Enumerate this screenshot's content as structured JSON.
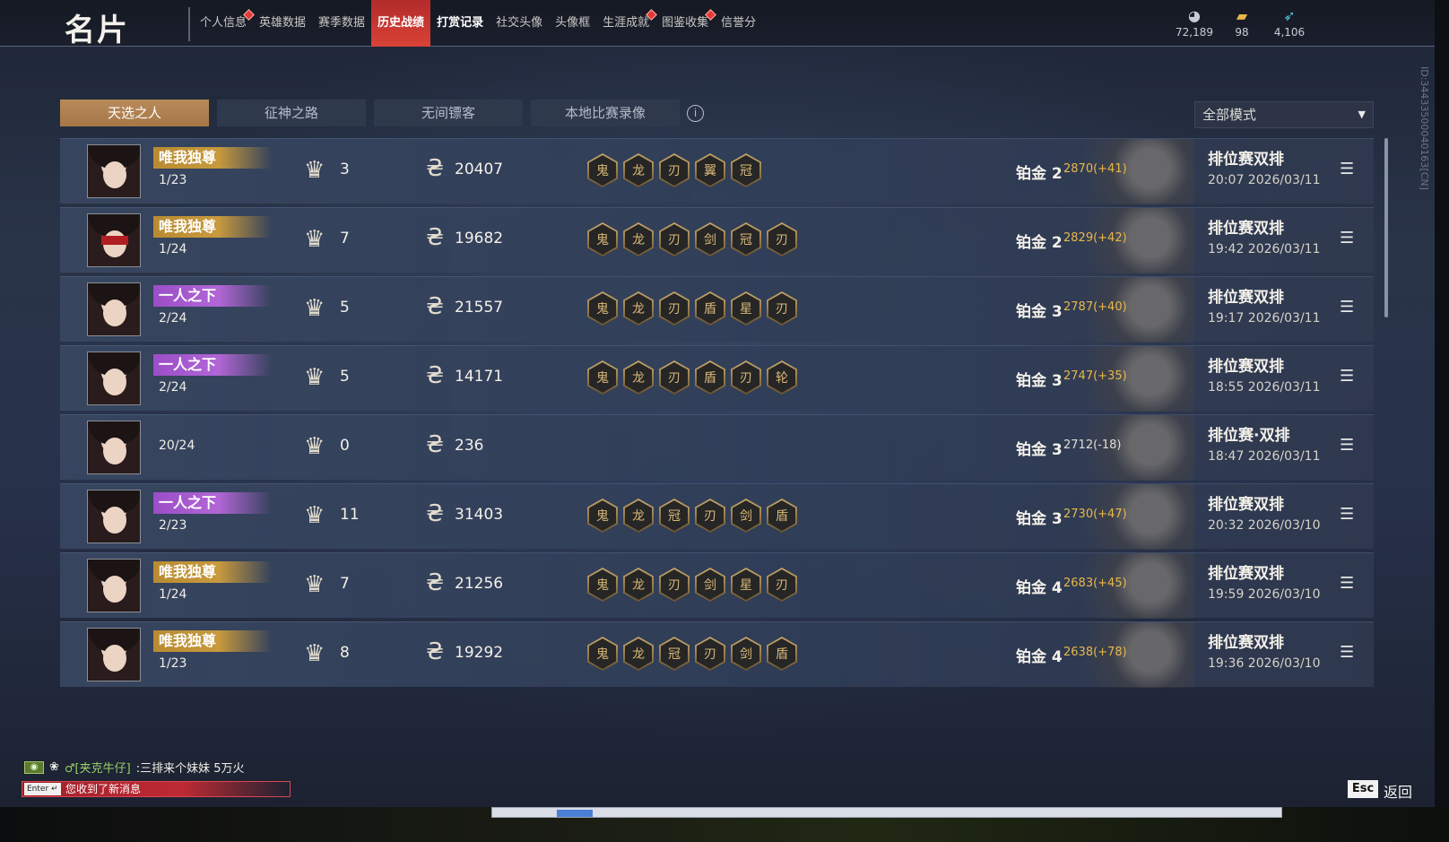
{
  "header": {
    "title": "名片",
    "nav": [
      {
        "label": "个人信息",
        "dot": true,
        "state": "normal"
      },
      {
        "label": "英雄数据",
        "dot": false,
        "state": "normal"
      },
      {
        "label": "赛季数据",
        "dot": false,
        "state": "normal"
      },
      {
        "label": "历史战绩",
        "dot": false,
        "state": "active"
      },
      {
        "label": "打赏记录",
        "dot": false,
        "state": "bold"
      },
      {
        "label": "社交头像",
        "dot": false,
        "state": "normal"
      },
      {
        "label": "头像框",
        "dot": false,
        "state": "normal"
      },
      {
        "label": "生涯成就",
        "dot": true,
        "state": "normal"
      },
      {
        "label": "图鉴收集",
        "dot": true,
        "state": "normal"
      },
      {
        "label": "信誉分",
        "dot": false,
        "state": "normal"
      }
    ],
    "currencies": [
      {
        "icon": "coin-stack-icon",
        "value": "72,189",
        "color": "#c8ccd4"
      },
      {
        "icon": "ticket-icon",
        "value": "98",
        "color": "#e8b84a"
      },
      {
        "icon": "feather-icon",
        "value": "4,106",
        "color": "#4ac8e0"
      }
    ]
  },
  "side_id": "ID:34433500040163[CN]",
  "tabs": [
    {
      "label": "天选之人",
      "active": true
    },
    {
      "label": "征神之路",
      "active": false
    },
    {
      "label": "无间镖客",
      "active": false
    },
    {
      "label": "本地比赛录像",
      "active": false
    }
  ],
  "mode_select": {
    "value": "全部模式"
  },
  "matches": [
    {
      "title": "唯我独尊",
      "title_color": "gold",
      "rank": "1/23",
      "kills": "3",
      "damage": "20407",
      "medals": [
        "鬼",
        "龙",
        "刃",
        "翼",
        "冠"
      ],
      "tier": "铂金 2",
      "score": "2870(+41)",
      "mode": "排位赛双排",
      "time": "20:07  2026/03/11",
      "avatar": "plain"
    },
    {
      "title": "唯我独尊",
      "title_color": "gold",
      "rank": "1/24",
      "kills": "7",
      "damage": "19682",
      "medals": [
        "鬼",
        "龙",
        "刃",
        "剑",
        "冠",
        "刃"
      ],
      "tier": "铂金 2",
      "score": "2829(+42)",
      "mode": "排位赛双排",
      "time": "19:42  2026/03/11",
      "avatar": "masked"
    },
    {
      "title": "一人之下",
      "title_color": "purple",
      "rank": "2/24",
      "kills": "5",
      "damage": "21557",
      "medals": [
        "鬼",
        "龙",
        "刃",
        "盾",
        "星",
        "刃"
      ],
      "tier": "铂金 3",
      "score": "2787(+40)",
      "mode": "排位赛双排",
      "time": "19:17  2026/03/11",
      "avatar": "plain"
    },
    {
      "title": "一人之下",
      "title_color": "purple",
      "rank": "2/24",
      "kills": "5",
      "damage": "14171",
      "medals": [
        "鬼",
        "龙",
        "刃",
        "盾",
        "刃",
        "轮"
      ],
      "tier": "铂金 3",
      "score": "2747(+35)",
      "mode": "排位赛双排",
      "time": "18:55  2026/03/11",
      "avatar": "plain"
    },
    {
      "title": "",
      "title_color": "none",
      "rank": "20/24",
      "kills": "0",
      "damage": "236",
      "medals": [],
      "tier": "铂金 3",
      "score": "2712(-18)",
      "mode": "排位赛·双排",
      "time": "18:47  2026/03/11",
      "avatar": "plain"
    },
    {
      "title": "一人之下",
      "title_color": "purple",
      "rank": "2/23",
      "kills": "11",
      "damage": "31403",
      "medals": [
        "鬼",
        "龙",
        "冠",
        "刃",
        "剑",
        "盾"
      ],
      "tier": "铂金 3",
      "score": "2730(+47)",
      "mode": "排位赛双排",
      "time": "20:32  2026/03/10",
      "avatar": "plain"
    },
    {
      "title": "唯我独尊",
      "title_color": "gold",
      "rank": "1/24",
      "kills": "7",
      "damage": "21256",
      "medals": [
        "鬼",
        "龙",
        "刃",
        "剑",
        "星",
        "刃"
      ],
      "tier": "铂金 4",
      "score": "2683(+45)",
      "mode": "排位赛双排",
      "time": "19:59  2026/03/10",
      "avatar": "plain"
    },
    {
      "title": "唯我独尊",
      "title_color": "gold",
      "rank": "1/23",
      "kills": "8",
      "damage": "19292",
      "medals": [
        "鬼",
        "龙",
        "冠",
        "刃",
        "剑",
        "盾"
      ],
      "tier": "铂金 4",
      "score": "2638(+78)",
      "mode": "排位赛双排",
      "time": "19:36  2026/03/10",
      "avatar": "plain"
    }
  ],
  "chat": {
    "sender": "♂[夹克牛仔]",
    "message": ":三排来个妹妹 5万火"
  },
  "notification": {
    "key": "Enter ↵",
    "text": "您收到了新消息"
  },
  "esc": {
    "key": "Esc",
    "label": "返回"
  }
}
